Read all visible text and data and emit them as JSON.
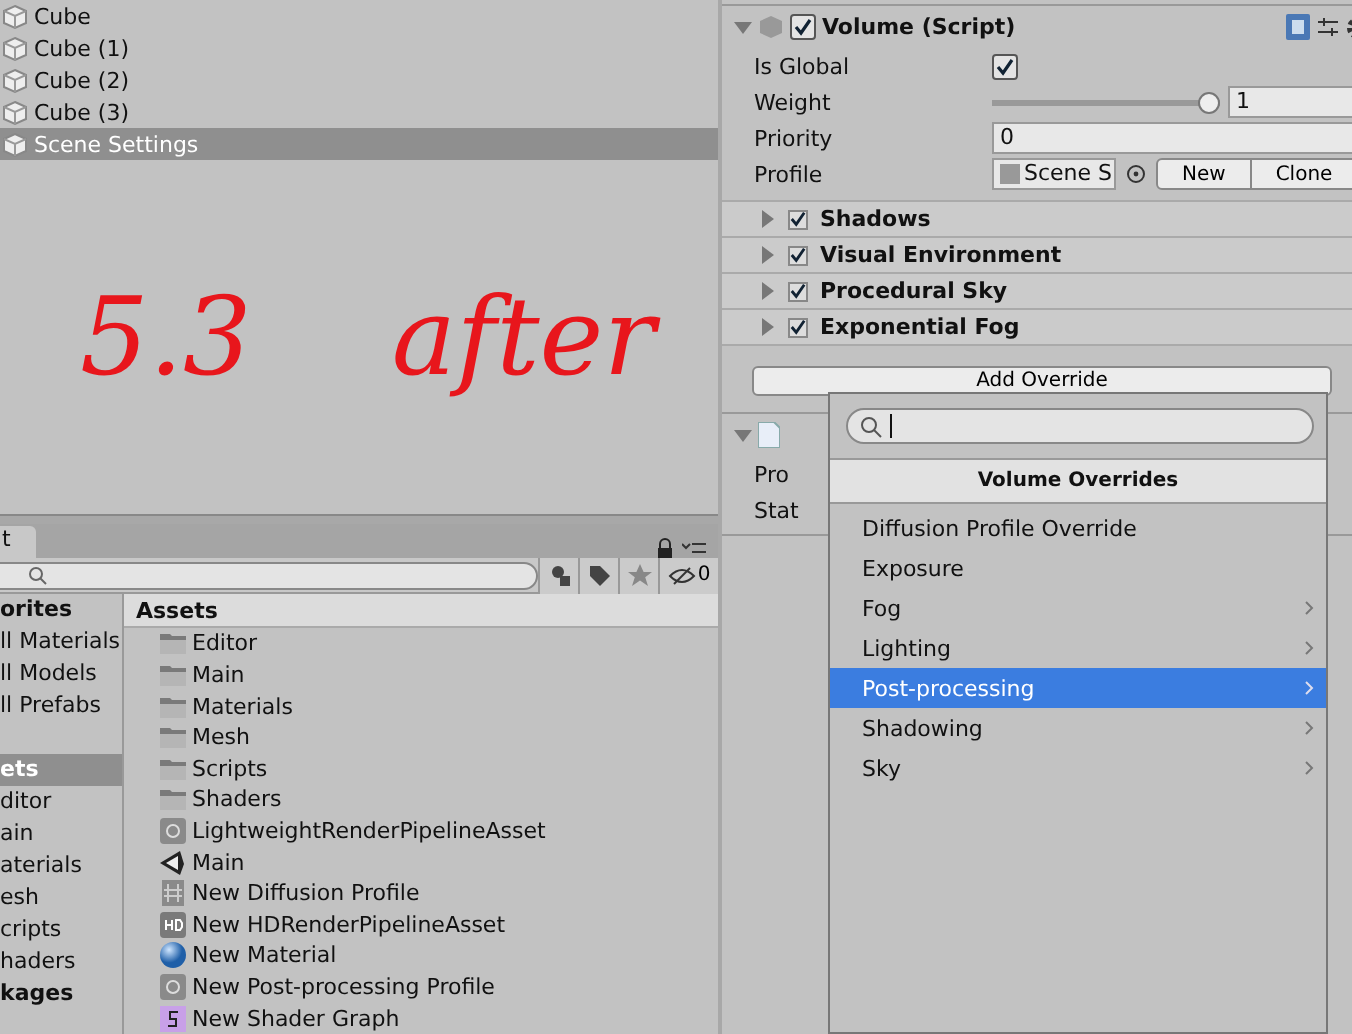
{
  "hierarchy": {
    "items": [
      {
        "label": "Cube",
        "selected": false
      },
      {
        "label": "Cube (1)",
        "selected": false
      },
      {
        "label": "Cube (2)",
        "selected": false
      },
      {
        "label": "Cube (3)",
        "selected": false
      },
      {
        "label": "Scene Settings",
        "selected": true
      }
    ]
  },
  "annotation": [
    "5.3",
    "after"
  ],
  "inspector": {
    "component": {
      "title": "Volume (Script)",
      "enabled": true,
      "expanded": true
    },
    "fields": [
      {
        "kind": "checkbox",
        "label": "Is Global",
        "checked": true
      },
      {
        "kind": "slider",
        "label": "Weight",
        "level": 1,
        "value": "1"
      },
      {
        "kind": "text",
        "label": "Priority",
        "value": "0"
      },
      {
        "kind": "object",
        "label": "Profile",
        "value": "Scene S",
        "buttons": [
          "New",
          "Clone"
        ]
      }
    ],
    "overrides": [
      {
        "label": "Shadows",
        "checked": true
      },
      {
        "label": "Visual Environment",
        "checked": true
      },
      {
        "label": "Procedural Sky",
        "checked": true
      },
      {
        "label": "Exponential Fog",
        "checked": true
      }
    ],
    "add_button": "Add Override",
    "second_component": {
      "expanded": true,
      "fields": [
        "Pro",
        "Stat"
      ]
    }
  },
  "project": {
    "tab": "t",
    "filter_count": "0",
    "favorites": {
      "title": "orites",
      "items": [
        "ll Materials",
        "ll Models",
        "ll Prefabs"
      ]
    },
    "tree": [
      {
        "label": "ets",
        "selected": true,
        "children": [
          {
            "label": "ditor",
            "selected": false
          },
          {
            "label": "ain",
            "selected": false
          },
          {
            "label": "aterials",
            "selected": false
          },
          {
            "label": "esh",
            "selected": false
          },
          {
            "label": "cripts",
            "selected": false
          },
          {
            "label": "haders",
            "selected": false
          }
        ]
      }
    ],
    "packages": "kages",
    "breadcrumb": "Assets",
    "assets": [
      {
        "kind": "folder",
        "name": "Editor"
      },
      {
        "kind": "folder",
        "name": "Main"
      },
      {
        "kind": "folder",
        "name": "Materials"
      },
      {
        "kind": "folder",
        "name": "Mesh"
      },
      {
        "kind": "folder",
        "name": "Scripts"
      },
      {
        "kind": "folder",
        "name": "Shaders"
      },
      {
        "kind": "pipeline",
        "name": "LightweightRenderPipelineAsset"
      },
      {
        "kind": "unity",
        "name": "Main"
      },
      {
        "kind": "diffusion",
        "name": "New Diffusion Profile"
      },
      {
        "kind": "hd",
        "name": "New HDRenderPipelineAsset"
      },
      {
        "kind": "material",
        "name": "New Material"
      },
      {
        "kind": "pipeline",
        "name": "New Post-processing Profile"
      },
      {
        "kind": "shader",
        "name": "New Shader Graph"
      }
    ]
  },
  "popup": {
    "title": "Volume Overrides",
    "items": [
      {
        "label": "Diffusion Profile Override",
        "submenu": false,
        "selected": false
      },
      {
        "label": "Exposure",
        "submenu": false,
        "selected": false
      },
      {
        "label": "Fog",
        "submenu": true,
        "selected": false
      },
      {
        "label": "Lighting",
        "submenu": true,
        "selected": false
      },
      {
        "label": "Post-processing",
        "submenu": true,
        "selected": true
      },
      {
        "label": "Shadowing",
        "submenu": true,
        "selected": false
      },
      {
        "label": "Sky",
        "submenu": true,
        "selected": false
      }
    ]
  }
}
